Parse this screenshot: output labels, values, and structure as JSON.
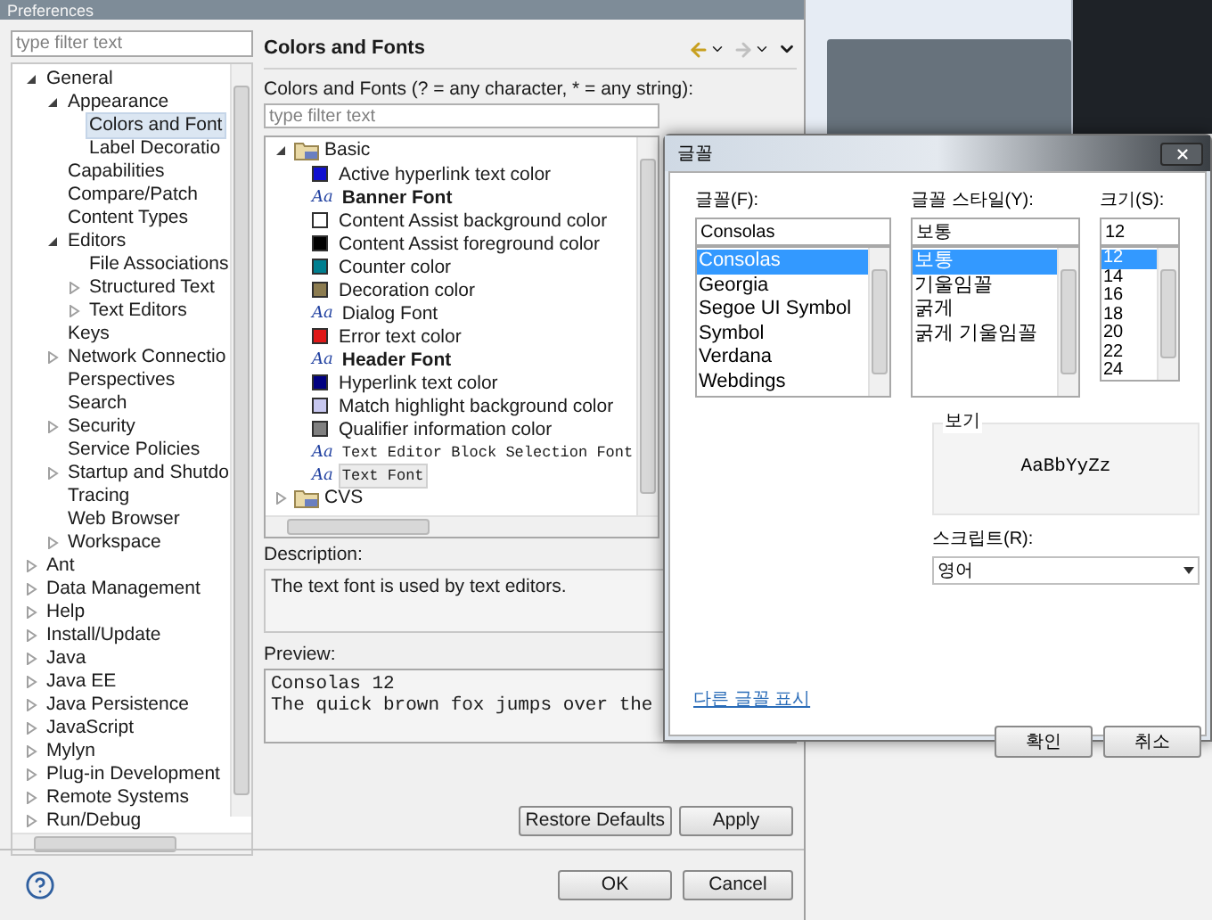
{
  "preferences": {
    "title": "Preferences",
    "filter_placeholder": "type filter text",
    "tree": [
      {
        "label": "General",
        "expanded": true,
        "children": [
          {
            "label": "Appearance",
            "expanded": true,
            "children": [
              {
                "label": "Colors and Font",
                "selected": true
              },
              {
                "label": "Label Decoratio",
                "selected": false
              }
            ]
          },
          {
            "label": "Capabilities"
          },
          {
            "label": "Compare/Patch"
          },
          {
            "label": "Content Types"
          },
          {
            "label": "Editors",
            "expanded": true,
            "children": [
              {
                "label": "File Associations"
              },
              {
                "label": "Structured Text",
                "expanded": false
              },
              {
                "label": "Text Editors",
                "expanded": false
              }
            ]
          },
          {
            "label": "Keys"
          },
          {
            "label": "Network Connectio",
            "expanded": false
          },
          {
            "label": "Perspectives"
          },
          {
            "label": "Search"
          },
          {
            "label": "Security",
            "expanded": false
          },
          {
            "label": "Service Policies"
          },
          {
            "label": "Startup and Shutdo",
            "expanded": false
          },
          {
            "label": "Tracing"
          },
          {
            "label": "Web Browser"
          },
          {
            "label": "Workspace",
            "expanded": false
          }
        ]
      },
      {
        "label": "Ant",
        "expanded": false
      },
      {
        "label": "Data Management",
        "expanded": false
      },
      {
        "label": "Help",
        "expanded": false
      },
      {
        "label": "Install/Update",
        "expanded": false
      },
      {
        "label": "Java",
        "expanded": false
      },
      {
        "label": "Java EE",
        "expanded": false
      },
      {
        "label": "Java Persistence",
        "expanded": false
      },
      {
        "label": "JavaScript",
        "expanded": false
      },
      {
        "label": "Mylyn",
        "expanded": false
      },
      {
        "label": "Plug-in Development",
        "expanded": false
      },
      {
        "label": "Remote Systems",
        "expanded": false
      },
      {
        "label": "Run/Debug",
        "expanded": false
      }
    ],
    "page_title": "Colors and Fonts",
    "filter_label": "Colors and Fonts (? = any character, * = any string):",
    "list_filter_placeholder": "type filter text",
    "categories": [
      {
        "label": "Basic",
        "expanded": true,
        "items": [
          {
            "kind": "color",
            "label": "Active hyperlink text color",
            "color": "#1010d0",
            "selected": false
          },
          {
            "kind": "bold-font",
            "label": "Banner Font",
            "icon": "Aa",
            "selected": false
          },
          {
            "kind": "color",
            "label": "Content Assist background color",
            "color": "#ffffff",
            "selected": false
          },
          {
            "kind": "color",
            "label": "Content Assist foreground color",
            "color": "#000000",
            "selected": false
          },
          {
            "kind": "color",
            "label": "Counter color",
            "color": "#007f90",
            "selected": false
          },
          {
            "kind": "color",
            "label": "Decoration color",
            "color": "#8c7c50",
            "selected": false
          },
          {
            "kind": "font",
            "label": "Dialog Font",
            "icon": "Aa",
            "selected": false
          },
          {
            "kind": "color",
            "label": "Error text color",
            "color": "#e01818",
            "selected": false
          },
          {
            "kind": "bold-font",
            "label": "Header Font",
            "icon": "Aa",
            "selected": false
          },
          {
            "kind": "color",
            "label": "Hyperlink text color",
            "color": "#000080",
            "selected": false
          },
          {
            "kind": "color",
            "label": "Match highlight background color",
            "color": "#c8c8f0",
            "selected": false
          },
          {
            "kind": "color",
            "label": "Qualifier information color",
            "color": "#808080",
            "selected": false
          },
          {
            "kind": "mono-font",
            "label": "Text Editor Block Selection Font",
            "icon": "Aa",
            "selected": false
          },
          {
            "kind": "mono-font",
            "label": "Text Font",
            "icon": "Aa",
            "selected": true
          }
        ]
      },
      {
        "label": "CVS",
        "expanded": false
      }
    ],
    "description_label": "Description:",
    "description": "The text font is used by text editors.",
    "preview_label": "Preview:",
    "preview_lines": [
      "Consolas 12",
      "The quick brown fox jumps over the"
    ],
    "restore_button": "Restore Defaults",
    "apply_button": "Apply",
    "ok_button": "OK",
    "cancel_button": "Cancel"
  },
  "font_dialog": {
    "title": "글꼴",
    "font_label": "글꼴(F):",
    "font_value": "Consolas",
    "fonts": [
      {
        "label": "Consolas",
        "selected": true
      },
      {
        "label": "Georgia",
        "selected": false
      },
      {
        "label": "Segoe UI Symbol",
        "selected": false
      },
      {
        "label": "Symbol",
        "selected": false
      },
      {
        "label": "Verdana",
        "selected": false
      },
      {
        "label": "Webdings",
        "selected": false
      }
    ],
    "style_label": "글꼴 스타일(Y):",
    "style_value": "보통",
    "styles": [
      {
        "label": "보통",
        "selected": true
      },
      {
        "label": "기울임꼴",
        "selected": false
      },
      {
        "label": "굵게",
        "selected": false
      },
      {
        "label": "굵게 기울임꼴",
        "selected": false
      }
    ],
    "size_label": "크기(S):",
    "size_value": "12",
    "sizes": [
      {
        "label": "12",
        "selected": true
      },
      {
        "label": "14",
        "selected": false
      },
      {
        "label": "16",
        "selected": false
      },
      {
        "label": "18",
        "selected": false
      },
      {
        "label": "20",
        "selected": false
      },
      {
        "label": "22",
        "selected": false
      },
      {
        "label": "24",
        "selected": false
      }
    ],
    "sample_label": "보기",
    "sample_text": "AaBbYyZz",
    "script_label": "스크립트(R):",
    "script_value": "영어",
    "more_fonts_link": "다른 글꼴 표시",
    "ok_button": "확인",
    "cancel_button": "취소"
  }
}
